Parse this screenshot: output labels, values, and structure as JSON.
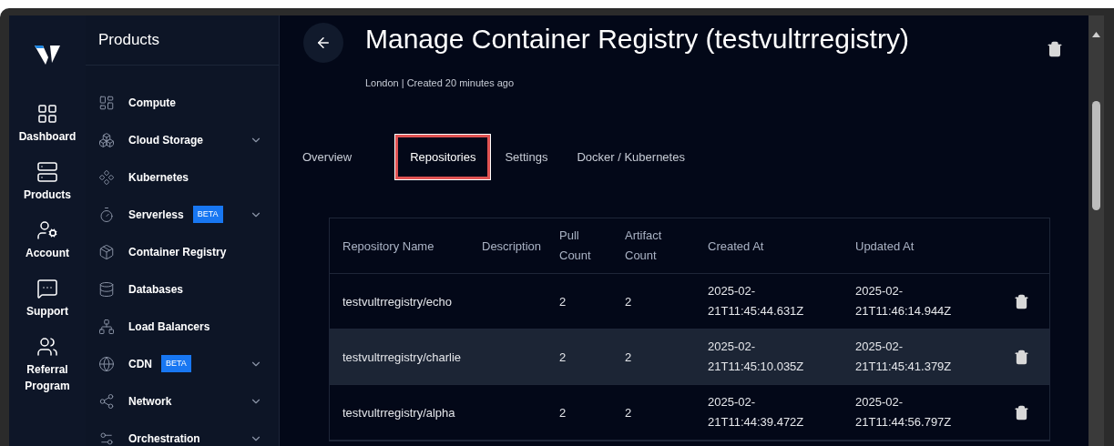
{
  "nav_rail": [
    {
      "label": "Dashboard"
    },
    {
      "label": "Products"
    },
    {
      "label": "Account"
    },
    {
      "label": "Support"
    },
    {
      "label": "Referral Program"
    }
  ],
  "products_panel": {
    "title": "Products",
    "items": [
      {
        "label": "Compute",
        "expandable": false
      },
      {
        "label": "Cloud Storage",
        "expandable": true
      },
      {
        "label": "Kubernetes",
        "expandable": false
      },
      {
        "label": "Serverless",
        "badge": "BETA",
        "expandable": true
      },
      {
        "label": "Container Registry",
        "expandable": false
      },
      {
        "label": "Databases",
        "expandable": false
      },
      {
        "label": "Load Balancers",
        "expandable": false
      },
      {
        "label": "CDN",
        "badge": "BETA",
        "expandable": true
      },
      {
        "label": "Network",
        "expandable": true
      },
      {
        "label": "Orchestration",
        "expandable": true
      }
    ]
  },
  "page": {
    "title": "Manage Container Registry (testvultrregistry)",
    "subtitle": "London | Created 20 minutes ago"
  },
  "tabs": [
    {
      "label": "Overview",
      "selected": false
    },
    {
      "label": "Repositories",
      "selected": true
    },
    {
      "label": "Settings",
      "selected": false
    },
    {
      "label": "Docker / Kubernetes",
      "selected": false
    }
  ],
  "table": {
    "columns": [
      "Repository Name",
      "Description",
      "Pull Count",
      "Artifact Count",
      "Created At",
      "Updated At"
    ],
    "rows": [
      {
        "cells": [
          "testvultrregistry/echo",
          "",
          "2",
          "2",
          "2025-02-21T11:45:44.631Z",
          "2025-02-21T11:46:14.944Z"
        ],
        "highlighted": false
      },
      {
        "cells": [
          "testvultrregistry/charlie",
          "",
          "2",
          "2",
          "2025-02-21T11:45:10.035Z",
          "2025-02-21T11:45:41.379Z"
        ],
        "highlighted": true
      },
      {
        "cells": [
          "testvultrregistry/alpha",
          "",
          "2",
          "2",
          "2025-02-21T11:44:39.472Z",
          "2025-02-21T11:44:56.797Z"
        ],
        "highlighted": false
      }
    ]
  }
}
